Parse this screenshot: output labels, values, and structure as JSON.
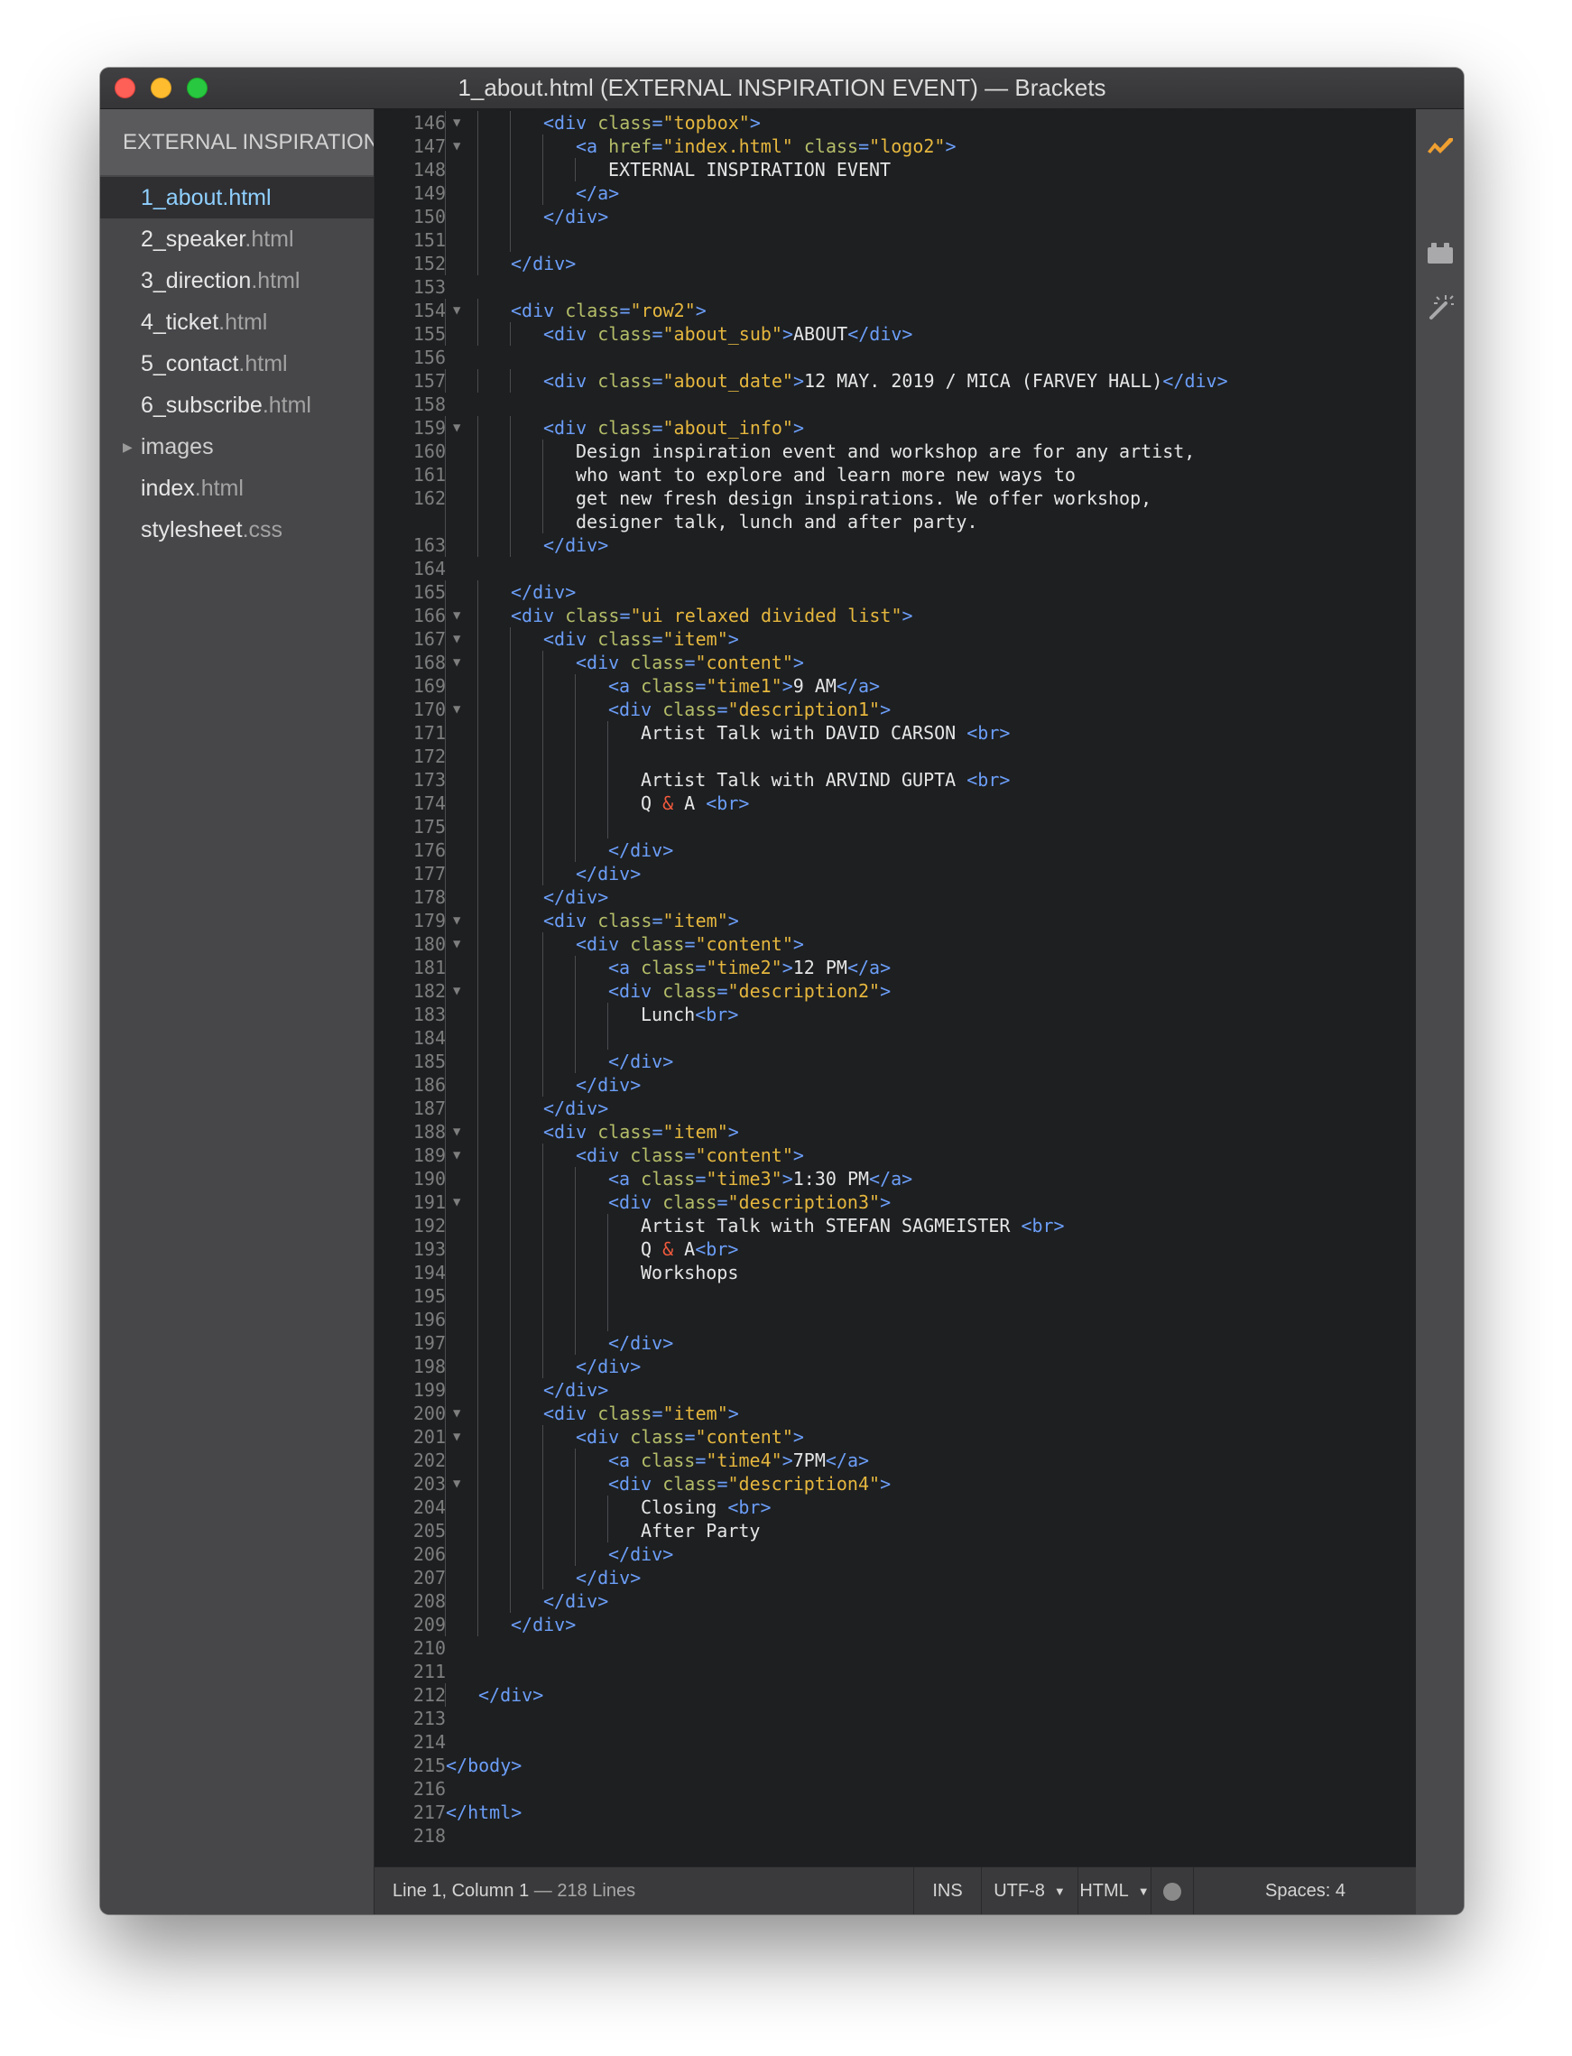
{
  "window": {
    "title": "1_about.html (EXTERNAL INSPIRATION EVENT) — Brackets"
  },
  "sidebar": {
    "project_name": "EXTERNAL INSPIRATION EVENT",
    "items": [
      {
        "name": "1_about",
        "ext": ".html",
        "type": "file",
        "selected": true
      },
      {
        "name": "2_speaker",
        "ext": ".html",
        "type": "file"
      },
      {
        "name": "3_direction",
        "ext": ".html",
        "type": "file"
      },
      {
        "name": "4_ticket",
        "ext": ".html",
        "type": "file"
      },
      {
        "name": "5_contact",
        "ext": ".html",
        "type": "file"
      },
      {
        "name": "6_subscribe",
        "ext": ".html",
        "type": "file"
      },
      {
        "name": "images",
        "ext": "",
        "type": "folder"
      },
      {
        "name": "index",
        "ext": ".html",
        "type": "file"
      },
      {
        "name": "stylesheet",
        "ext": ".css",
        "type": "file"
      }
    ]
  },
  "toolbar": {
    "icons": [
      "live-preview-icon",
      "extension-manager-icon",
      "linting-magic-wand-icon"
    ],
    "accent": "#f0a030"
  },
  "status": {
    "cursor": "Line 1, Column 1",
    "separator": " — ",
    "lines": "218 Lines",
    "mode": "INS",
    "encoding": "UTF-8",
    "language": "HTML",
    "spaces": "Spaces:  4"
  },
  "colors": {
    "tag": "#6c9ef8",
    "attribute": "#b5bd68",
    "string": "#e6b73e",
    "entity": "#f15a3d",
    "text": "#e6e6e6"
  },
  "code": {
    "lines": [
      {
        "n": "146",
        "fold": true,
        "i": 3,
        "t": [
          [
            "t",
            "<div "
          ],
          [
            "a",
            "class"
          ],
          [
            "t",
            "="
          ],
          [
            "s",
            "\"topbox\""
          ],
          [
            "t",
            ">"
          ]
        ]
      },
      {
        "n": "147",
        "fold": true,
        "i": 4,
        "t": [
          [
            "t",
            "<a "
          ],
          [
            "a",
            "href"
          ],
          [
            "t",
            "="
          ],
          [
            "s",
            "\"index.html\""
          ],
          [
            "t",
            " "
          ],
          [
            "a",
            "class"
          ],
          [
            "t",
            "="
          ],
          [
            "s",
            "\"logo2\""
          ],
          [
            "t",
            ">"
          ]
        ]
      },
      {
        "n": "148",
        "i": 5,
        "t": [
          [
            "x",
            "EXTERNAL INSPIRATION EVENT"
          ]
        ]
      },
      {
        "n": "149",
        "i": 4,
        "t": [
          [
            "t",
            "</a>"
          ]
        ]
      },
      {
        "n": "150",
        "i": 3,
        "t": [
          [
            "t",
            "</div>"
          ]
        ]
      },
      {
        "n": "151",
        "i": 0,
        "g": 3,
        "t": []
      },
      {
        "n": "152",
        "i": 2,
        "t": [
          [
            "t",
            "</div>"
          ]
        ]
      },
      {
        "n": "153",
        "i": 0,
        "t": []
      },
      {
        "n": "154",
        "fold": true,
        "i": 2,
        "t": [
          [
            "t",
            "<div "
          ],
          [
            "a",
            "class"
          ],
          [
            "t",
            "="
          ],
          [
            "s",
            "\"row2\""
          ],
          [
            "t",
            ">"
          ]
        ]
      },
      {
        "n": "155",
        "i": 3,
        "t": [
          [
            "t",
            "<div "
          ],
          [
            "a",
            "class"
          ],
          [
            "t",
            "="
          ],
          [
            "s",
            "\"about_sub\""
          ],
          [
            "t",
            ">"
          ],
          [
            "x",
            "ABOUT"
          ],
          [
            "t",
            "</div>"
          ]
        ]
      },
      {
        "n": "156",
        "i": 0,
        "t": []
      },
      {
        "n": "157",
        "i": 3,
        "t": [
          [
            "t",
            "<div "
          ],
          [
            "a",
            "class"
          ],
          [
            "t",
            "="
          ],
          [
            "s",
            "\"about_date\""
          ],
          [
            "t",
            ">"
          ],
          [
            "x",
            "12 MAY. 2019 / MICA (FARVEY HALL)"
          ],
          [
            "t",
            "</div>"
          ]
        ]
      },
      {
        "n": "158",
        "i": 0,
        "t": []
      },
      {
        "n": "159",
        "fold": true,
        "i": 3,
        "t": [
          [
            "t",
            "<div "
          ],
          [
            "a",
            "class"
          ],
          [
            "t",
            "="
          ],
          [
            "s",
            "\"about_info\""
          ],
          [
            "t",
            ">"
          ]
        ]
      },
      {
        "n": "160",
        "i": 4,
        "t": [
          [
            "x",
            "Design inspiration event and workshop are for any artist,"
          ]
        ]
      },
      {
        "n": "161",
        "i": 4,
        "t": [
          [
            "x",
            "who want to explore and learn more new ways to"
          ]
        ]
      },
      {
        "n": "162",
        "i": 4,
        "t": [
          [
            "x",
            "get new fresh design inspirations. We offer workshop,"
          ]
        ]
      },
      {
        "n": "",
        "i": 4,
        "t": [
          [
            "x",
            "designer talk, lunch and after party."
          ]
        ]
      },
      {
        "n": "163",
        "i": 3,
        "t": [
          [
            "t",
            "</div>"
          ]
        ]
      },
      {
        "n": "164",
        "i": 0,
        "t": []
      },
      {
        "n": "165",
        "i": 2,
        "t": [
          [
            "t",
            "</div>"
          ]
        ]
      },
      {
        "n": "166",
        "fold": true,
        "i": 2,
        "t": [
          [
            "t",
            "<div "
          ],
          [
            "a",
            "class"
          ],
          [
            "t",
            "="
          ],
          [
            "s",
            "\"ui relaxed divided list\""
          ],
          [
            "t",
            ">"
          ]
        ]
      },
      {
        "n": "167",
        "fold": true,
        "i": 3,
        "t": [
          [
            "t",
            "<div "
          ],
          [
            "a",
            "class"
          ],
          [
            "t",
            "="
          ],
          [
            "s",
            "\"item\""
          ],
          [
            "t",
            ">"
          ]
        ]
      },
      {
        "n": "168",
        "fold": true,
        "i": 4,
        "t": [
          [
            "t",
            "<div "
          ],
          [
            "a",
            "class"
          ],
          [
            "t",
            "="
          ],
          [
            "s",
            "\"content\""
          ],
          [
            "t",
            ">"
          ]
        ]
      },
      {
        "n": "169",
        "i": 5,
        "t": [
          [
            "t",
            "<a "
          ],
          [
            "a",
            "class"
          ],
          [
            "t",
            "="
          ],
          [
            "s",
            "\"time1\""
          ],
          [
            "t",
            ">"
          ],
          [
            "x",
            "9 AM"
          ],
          [
            "t",
            "</a>"
          ]
        ]
      },
      {
        "n": "170",
        "fold": true,
        "i": 5,
        "t": [
          [
            "t",
            "<div "
          ],
          [
            "a",
            "class"
          ],
          [
            "t",
            "="
          ],
          [
            "s",
            "\"description1\""
          ],
          [
            "t",
            ">"
          ]
        ]
      },
      {
        "n": "171",
        "i": 6,
        "t": [
          [
            "x",
            "Artist Talk with DAVID CARSON "
          ],
          [
            "t",
            "<br>"
          ]
        ]
      },
      {
        "n": "172",
        "i": 0,
        "g": 6,
        "t": []
      },
      {
        "n": "173",
        "i": 6,
        "t": [
          [
            "x",
            "Artist Talk with ARVIND GUPTA "
          ],
          [
            "t",
            "<br>"
          ]
        ]
      },
      {
        "n": "174",
        "i": 6,
        "t": [
          [
            "x",
            "Q "
          ],
          [
            "e",
            "&"
          ],
          [
            "x",
            " A "
          ],
          [
            "t",
            "<br>"
          ]
        ]
      },
      {
        "n": "175",
        "i": 0,
        "g": 6,
        "t": []
      },
      {
        "n": "176",
        "i": 5,
        "t": [
          [
            "t",
            "</div>"
          ]
        ]
      },
      {
        "n": "177",
        "i": 4,
        "t": [
          [
            "t",
            "</div>"
          ]
        ]
      },
      {
        "n": "178",
        "i": 3,
        "t": [
          [
            "t",
            "</div>"
          ]
        ]
      },
      {
        "n": "179",
        "fold": true,
        "i": 3,
        "t": [
          [
            "t",
            "<div "
          ],
          [
            "a",
            "class"
          ],
          [
            "t",
            "="
          ],
          [
            "s",
            "\"item\""
          ],
          [
            "t",
            ">"
          ]
        ]
      },
      {
        "n": "180",
        "fold": true,
        "i": 4,
        "t": [
          [
            "t",
            "<div "
          ],
          [
            "a",
            "class"
          ],
          [
            "t",
            "="
          ],
          [
            "s",
            "\"content\""
          ],
          [
            "t",
            ">"
          ]
        ]
      },
      {
        "n": "181",
        "i": 5,
        "t": [
          [
            "t",
            "<a "
          ],
          [
            "a",
            "class"
          ],
          [
            "t",
            "="
          ],
          [
            "s",
            "\"time2\""
          ],
          [
            "t",
            ">"
          ],
          [
            "x",
            "12 PM"
          ],
          [
            "t",
            "</a>"
          ]
        ]
      },
      {
        "n": "182",
        "fold": true,
        "i": 5,
        "t": [
          [
            "t",
            "<div "
          ],
          [
            "a",
            "class"
          ],
          [
            "t",
            "="
          ],
          [
            "s",
            "\"description2\""
          ],
          [
            "t",
            ">"
          ]
        ]
      },
      {
        "n": "183",
        "i": 6,
        "t": [
          [
            "x",
            "Lunch"
          ],
          [
            "t",
            "<br>"
          ]
        ]
      },
      {
        "n": "184",
        "i": 0,
        "g": 6,
        "t": []
      },
      {
        "n": "185",
        "i": 5,
        "t": [
          [
            "t",
            "</div>"
          ]
        ]
      },
      {
        "n": "186",
        "i": 4,
        "t": [
          [
            "t",
            "</div>"
          ]
        ]
      },
      {
        "n": "187",
        "i": 3,
        "t": [
          [
            "t",
            "</div>"
          ]
        ]
      },
      {
        "n": "188",
        "fold": true,
        "i": 3,
        "t": [
          [
            "t",
            "<div "
          ],
          [
            "a",
            "class"
          ],
          [
            "t",
            "="
          ],
          [
            "s",
            "\"item\""
          ],
          [
            "t",
            ">"
          ]
        ]
      },
      {
        "n": "189",
        "fold": true,
        "i": 4,
        "t": [
          [
            "t",
            "<div "
          ],
          [
            "a",
            "class"
          ],
          [
            "t",
            "="
          ],
          [
            "s",
            "\"content\""
          ],
          [
            "t",
            ">"
          ]
        ]
      },
      {
        "n": "190",
        "i": 5,
        "t": [
          [
            "t",
            "<a "
          ],
          [
            "a",
            "class"
          ],
          [
            "t",
            "="
          ],
          [
            "s",
            "\"time3\""
          ],
          [
            "t",
            ">"
          ],
          [
            "x",
            "1:30 PM"
          ],
          [
            "t",
            "</a>"
          ]
        ]
      },
      {
        "n": "191",
        "fold": true,
        "i": 5,
        "t": [
          [
            "t",
            "<div "
          ],
          [
            "a",
            "class"
          ],
          [
            "t",
            "="
          ],
          [
            "s",
            "\"description3\""
          ],
          [
            "t",
            ">"
          ]
        ]
      },
      {
        "n": "192",
        "i": 6,
        "t": [
          [
            "x",
            "Artist Talk with STEFAN SAGMEISTER "
          ],
          [
            "t",
            "<br>"
          ]
        ]
      },
      {
        "n": "193",
        "i": 6,
        "t": [
          [
            "x",
            "Q "
          ],
          [
            "e",
            "&"
          ],
          [
            "x",
            " A"
          ],
          [
            "t",
            "<br>"
          ]
        ]
      },
      {
        "n": "194",
        "i": 6,
        "t": [
          [
            "x",
            "Workshops"
          ]
        ]
      },
      {
        "n": "195",
        "i": 0,
        "g": 6,
        "t": []
      },
      {
        "n": "196",
        "i": 0,
        "g": 6,
        "t": []
      },
      {
        "n": "197",
        "i": 5,
        "t": [
          [
            "t",
            "</div>"
          ]
        ]
      },
      {
        "n": "198",
        "i": 4,
        "t": [
          [
            "t",
            "</div>"
          ]
        ]
      },
      {
        "n": "199",
        "i": 3,
        "t": [
          [
            "t",
            "</div>"
          ]
        ]
      },
      {
        "n": "200",
        "fold": true,
        "i": 3,
        "t": [
          [
            "t",
            "<div "
          ],
          [
            "a",
            "class"
          ],
          [
            "t",
            "="
          ],
          [
            "s",
            "\"item\""
          ],
          [
            "t",
            ">"
          ]
        ]
      },
      {
        "n": "201",
        "fold": true,
        "i": 4,
        "t": [
          [
            "t",
            "<div "
          ],
          [
            "a",
            "class"
          ],
          [
            "t",
            "="
          ],
          [
            "s",
            "\"content\""
          ],
          [
            "t",
            ">"
          ]
        ]
      },
      {
        "n": "202",
        "i": 5,
        "t": [
          [
            "t",
            "<a "
          ],
          [
            "a",
            "class"
          ],
          [
            "t",
            "="
          ],
          [
            "s",
            "\"time4\""
          ],
          [
            "t",
            ">"
          ],
          [
            "x",
            "7PM"
          ],
          [
            "t",
            "</a>"
          ]
        ]
      },
      {
        "n": "203",
        "fold": true,
        "i": 5,
        "t": [
          [
            "t",
            "<div "
          ],
          [
            "a",
            "class"
          ],
          [
            "t",
            "="
          ],
          [
            "s",
            "\"description4\""
          ],
          [
            "t",
            ">"
          ]
        ]
      },
      {
        "n": "204",
        "i": 6,
        "t": [
          [
            "x",
            "Closing "
          ],
          [
            "t",
            "<br>"
          ]
        ]
      },
      {
        "n": "205",
        "i": 6,
        "t": [
          [
            "x",
            "After Party"
          ]
        ]
      },
      {
        "n": "206",
        "i": 5,
        "t": [
          [
            "t",
            "</div>"
          ]
        ]
      },
      {
        "n": "207",
        "i": 4,
        "t": [
          [
            "t",
            "</div>"
          ]
        ]
      },
      {
        "n": "208",
        "i": 3,
        "t": [
          [
            "t",
            "</div>"
          ]
        ]
      },
      {
        "n": "209",
        "i": 2,
        "t": [
          [
            "t",
            "</div>"
          ]
        ]
      },
      {
        "n": "210",
        "i": 0,
        "t": []
      },
      {
        "n": "211",
        "i": 0,
        "t": []
      },
      {
        "n": "212",
        "i": 1,
        "t": [
          [
            "t",
            "</div>"
          ]
        ]
      },
      {
        "n": "213",
        "i": 0,
        "t": []
      },
      {
        "n": "214",
        "i": 0,
        "t": []
      },
      {
        "n": "215",
        "i": 0,
        "t": [
          [
            "t",
            "</body>"
          ]
        ]
      },
      {
        "n": "216",
        "i": 0,
        "t": []
      },
      {
        "n": "217",
        "i": 0,
        "t": [
          [
            "t",
            "</html>"
          ]
        ]
      },
      {
        "n": "218",
        "i": 0,
        "t": []
      }
    ]
  }
}
